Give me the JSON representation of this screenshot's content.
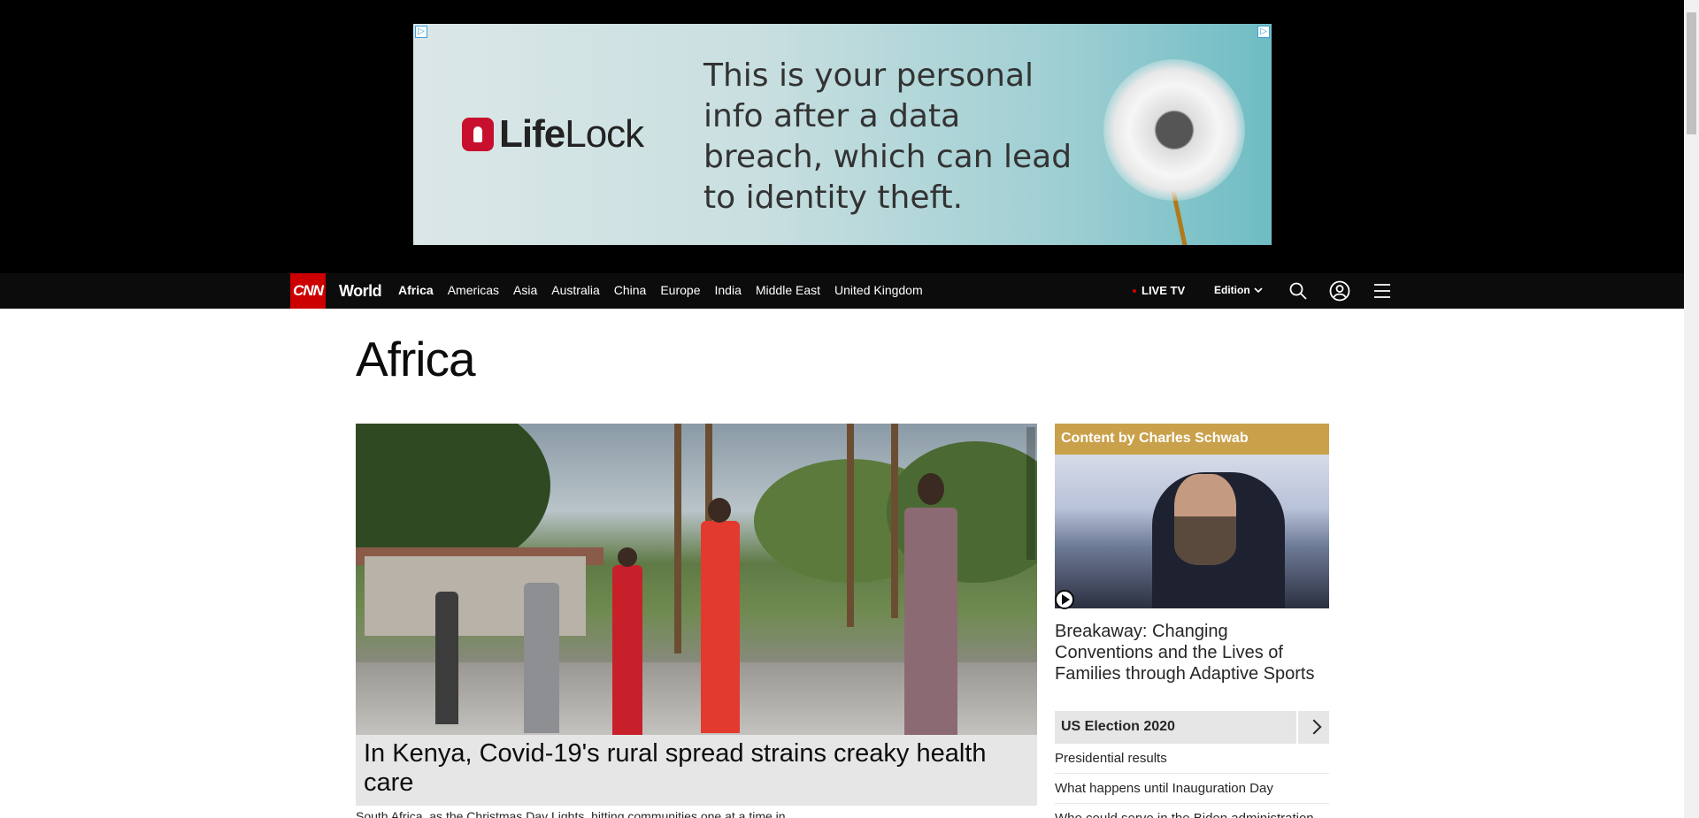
{
  "ad": {
    "brand_bold": "Life",
    "brand_light": "Lock",
    "copy": "This is your personal info after a data breach, which can lead to identity theft.",
    "choices_glyph": "▷"
  },
  "nav": {
    "logo": "CNN",
    "section": "World",
    "links": [
      "Africa",
      "Americas",
      "Asia",
      "Australia",
      "China",
      "Europe",
      "India",
      "Middle East",
      "United Kingdom"
    ],
    "live_tv": "LIVE TV",
    "edition": "Edition",
    "icons": [
      "search-icon",
      "account-icon",
      "menu-icon"
    ]
  },
  "page": {
    "title": "Africa"
  },
  "hero": {
    "headline": "In Kenya, Covid-19's rural spread strains creaky health care",
    "sub": "South Africa, as the Christmas Day Lights, hitting communities one at a time in"
  },
  "sponsored": {
    "label": "Content by Charles Schwab",
    "headline": "Breakaway: Changing Conventions and the Lives of Families through Adaptive Sports"
  },
  "election": {
    "title": "US Election 2020",
    "links": [
      "Presidential results",
      "What happens until Inauguration Day",
      "Who could serve in the Biden administration"
    ]
  },
  "colors": {
    "brand_red": "#cc0000",
    "sponsor_gold": "#c9a14b",
    "nav_bg": "#0c0c0c"
  }
}
